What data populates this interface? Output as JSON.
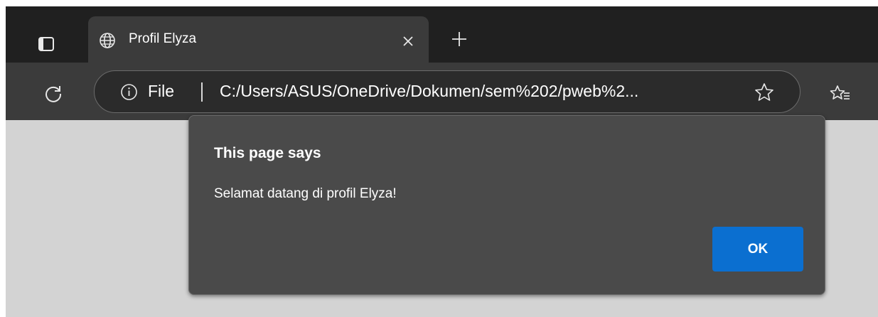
{
  "tab": {
    "title": "Profil Elyza",
    "favicon_icon": "globe-icon",
    "close_icon": "close-icon"
  },
  "tabstrip": {
    "tab_actions_icon": "tab-actions-icon",
    "new_tab_icon": "plus-icon"
  },
  "toolbar": {
    "reload_icon": "reload-icon",
    "site_info_icon": "info-icon",
    "scheme_label": "File",
    "url": "C:/Users/ASUS/OneDrive/Dokumen/sem%202/pweb%2...",
    "favorite_icon": "star-icon",
    "favorites_icon": "favorites-icon"
  },
  "dialog": {
    "title": "This page says",
    "message": "Selamat datang di profil Elyza!",
    "ok_label": "OK"
  },
  "colors": {
    "tabstrip_bg": "#202020",
    "toolbar_bg": "#3b3b3b",
    "dialog_bg": "#4a4a4a",
    "page_bg": "#d3d3d3",
    "accent": "#0b6fd0"
  }
}
